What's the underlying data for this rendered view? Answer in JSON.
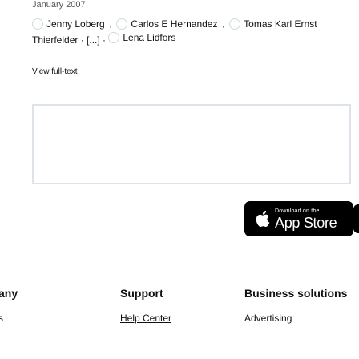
{
  "publication": {
    "date": "January 2007"
  },
  "authors": {
    "row1": [
      {
        "name": "Jenny Loberg",
        "sep": "·"
      },
      {
        "name": "Carlos E Hernandez",
        "sep": "·"
      },
      {
        "name": "Tomas Karl Ernst",
        "sep": ""
      }
    ],
    "row2_prefix": "Thierfelder · [...] ·",
    "row2": [
      {
        "name": "Lena Lidfors"
      }
    ]
  },
  "actions": {
    "view_fulltext": "View full-text"
  },
  "app_store_badge": {
    "small_text": "Download on the",
    "big_text": "App Store"
  },
  "footer": {
    "columns": [
      {
        "title": "any",
        "link": "s"
      },
      {
        "title": "Support",
        "link": "Help Center"
      },
      {
        "title": "Business solutions",
        "link": "Advertising"
      }
    ]
  }
}
